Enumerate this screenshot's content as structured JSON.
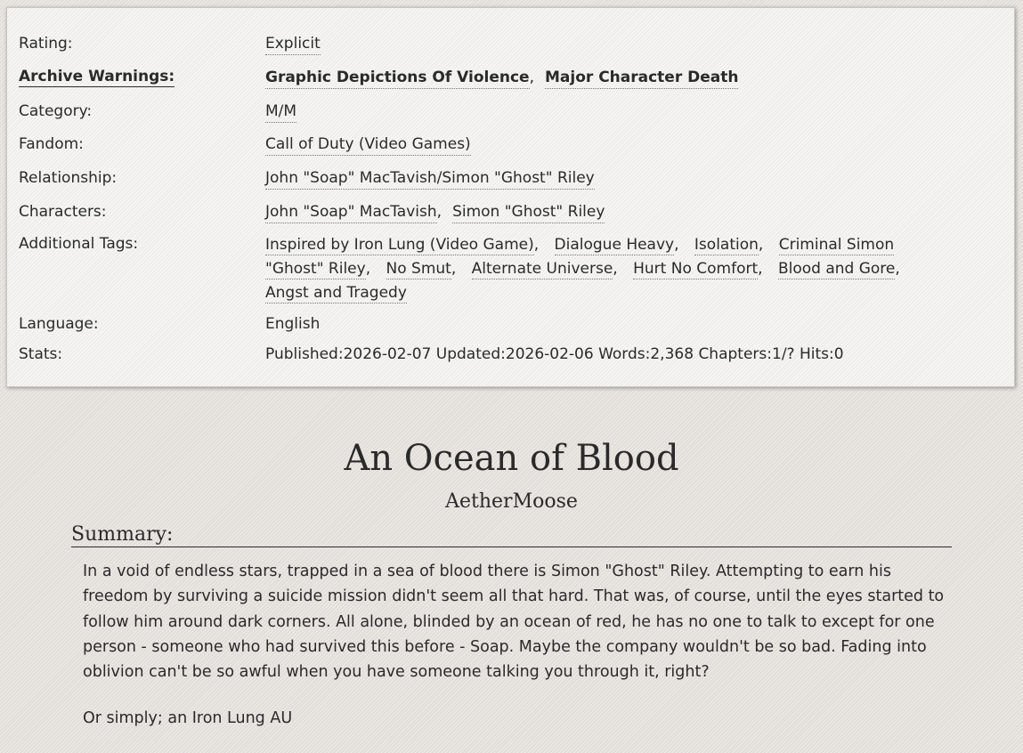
{
  "meta": {
    "rating": {
      "label": "Rating:",
      "tags": [
        "Explicit"
      ]
    },
    "warnings": {
      "label": "Archive Warnings:",
      "tags": [
        "Graphic Depictions Of Violence",
        "Major Character Death"
      ]
    },
    "category": {
      "label": "Category:",
      "tags": [
        "M/M"
      ]
    },
    "fandom": {
      "label": "Fandom:",
      "tags": [
        "Call of Duty (Video Games)"
      ]
    },
    "relationship": {
      "label": "Relationship:",
      "tags": [
        "John \"Soap\" MacTavish/Simon \"Ghost\" Riley"
      ]
    },
    "characters": {
      "label": "Characters:",
      "tags": [
        "John \"Soap\" MacTavish",
        "Simon \"Ghost\" Riley"
      ]
    },
    "additional": {
      "label": "Additional Tags:",
      "tags": [
        "Inspired by Iron Lung (Video Game)",
        "Dialogue Heavy",
        "Isolation",
        "Criminal Simon \"Ghost\" Riley",
        "No Smut",
        "Alternate Universe",
        "Hurt No Comfort",
        "Blood and Gore",
        "Angst and Tragedy"
      ]
    },
    "language": {
      "label": "Language:",
      "value": "English"
    },
    "stats": {
      "label": "Stats:",
      "published_label": "Published:",
      "published": "2026-02-07",
      "updated_label": "Updated:",
      "updated": "2026-02-06",
      "words_label": "Words:",
      "words": "2,368",
      "chapters_label": "Chapters:",
      "chapters": "1/?",
      "hits_label": "Hits:",
      "hits": "0"
    }
  },
  "work": {
    "title": "An Ocean of Blood",
    "author": "AetherMoose",
    "summary_heading": "Summary:",
    "summary_paragraphs": [
      "In a void of endless stars, trapped in a sea of blood there is Simon \"Ghost\" Riley. Attempting to earn his freedom by surviving a suicide mission didn't seem all that hard. That was, of course, until the eyes started to follow him around dark corners. All alone, blinded by an ocean of red, he has no one to talk to except for one person - someone who had survived this before - Soap. Maybe the company wouldn't be so bad. Fading into oblivion can't be so awful when you have someone talking you through it, right?",
      "Or simply; an Iron Lung AU"
    ]
  }
}
